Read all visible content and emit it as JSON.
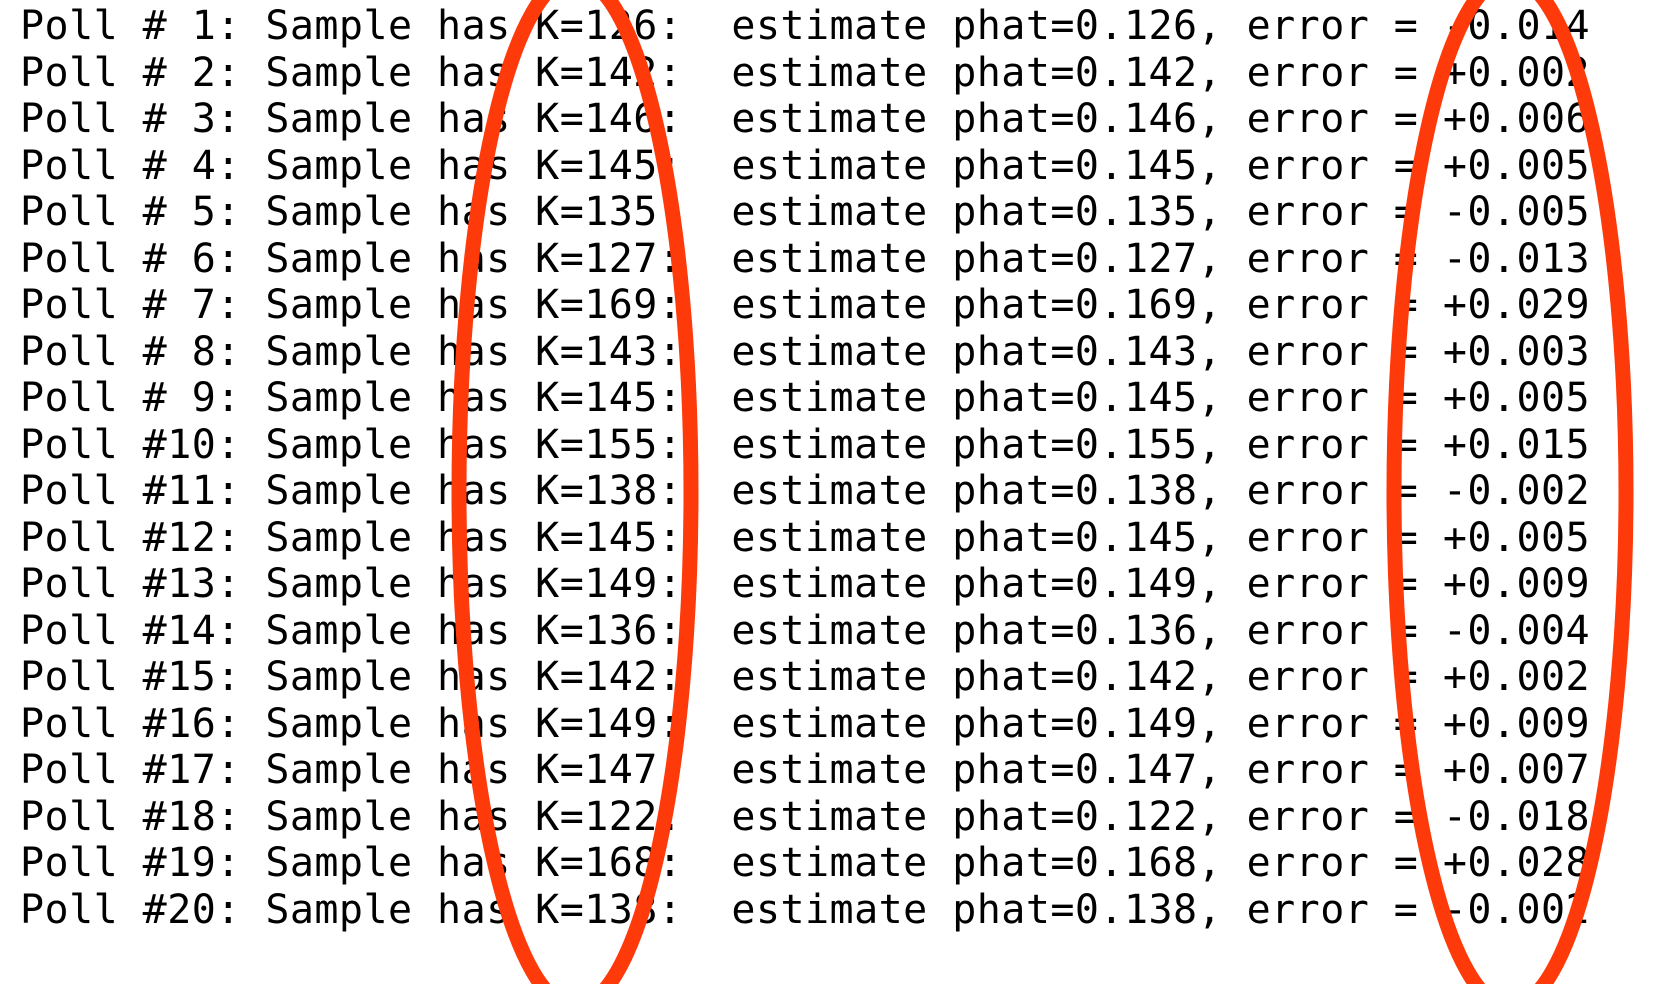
{
  "lines": [
    "Poll # 1: Sample has K=126:  estimate phat=0.126, error = -0.014",
    "Poll # 2: Sample has K=142:  estimate phat=0.142, error = +0.002",
    "Poll # 3: Sample has K=146:  estimate phat=0.146, error = +0.006",
    "Poll # 4: Sample has K=145:  estimate phat=0.145, error = +0.005",
    "Poll # 5: Sample has K=135:  estimate phat=0.135, error = -0.005",
    "Poll # 6: Sample has K=127:  estimate phat=0.127, error = -0.013",
    "Poll # 7: Sample has K=169:  estimate phat=0.169, error = +0.029",
    "Poll # 8: Sample has K=143:  estimate phat=0.143, error = +0.003",
    "Poll # 9: Sample has K=145:  estimate phat=0.145, error = +0.005",
    "Poll #10: Sample has K=155:  estimate phat=0.155, error = +0.015",
    "Poll #11: Sample has K=138:  estimate phat=0.138, error = -0.002",
    "Poll #12: Sample has K=145:  estimate phat=0.145, error = +0.005",
    "Poll #13: Sample has K=149:  estimate phat=0.149, error = +0.009",
    "Poll #14: Sample has K=136:  estimate phat=0.136, error = -0.004",
    "Poll #15: Sample has K=142:  estimate phat=0.142, error = +0.002",
    "Poll #16: Sample has K=149:  estimate phat=0.149, error = +0.009",
    "Poll #17: Sample has K=147:  estimate phat=0.147, error = +0.007",
    "Poll #18: Sample has K=122:  estimate phat=0.122, error = -0.018",
    "Poll #19: Sample has K=168:  estimate phat=0.168, error = +0.028",
    "Poll #20: Sample has K=138:  estimate phat=0.138, error = -0.002"
  ],
  "highlight_color": "#ff3a0a"
}
